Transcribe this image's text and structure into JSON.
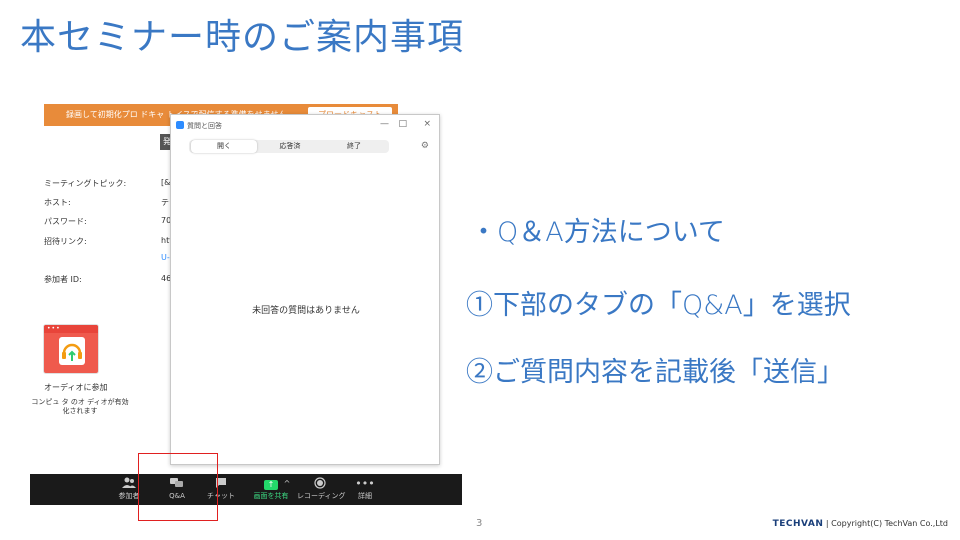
{
  "slide": {
    "title": "本セミナー時のご案内事項",
    "bullet": "・Q＆A方法について",
    "step1": "①下部のタブの「Q&A」を選択",
    "step2": "②ご質問内容を記載後「送信」",
    "page_number": "3",
    "footer_brand": "TECHVAN",
    "footer_copyright": "| Copyright(C) TechVan Co.,Ltd"
  },
  "zoom": {
    "banner_text": "録画して初期化プロ ドキャ トイスで配信する準備をせません",
    "banner_button": "プロードキャスト",
    "dark_tab": "発",
    "info": [
      {
        "label": "ミーティングトピック:",
        "value": "[&"
      },
      {
        "label": "ホスト:",
        "value": "テク"
      },
      {
        "label": "パスワード:",
        "value": "70"
      },
      {
        "label": "招待リンク:",
        "value": "htt"
      },
      {
        "label": "",
        "value": "U-c"
      },
      {
        "label": "参加者 ID:",
        "value": "46"
      }
    ],
    "audio_label": "オーディオに参加",
    "audio_sub": "コンピュ タ のオ ディオが有効化されます",
    "toolbar": [
      {
        "icon": "participants-icon",
        "label": "参加者"
      },
      {
        "icon": "qa-icon",
        "label": "Q&A"
      },
      {
        "icon": "chat-icon",
        "label": "チャット"
      },
      {
        "icon": "share-screen-icon",
        "label": "画面を共有"
      },
      {
        "icon": "record-icon",
        "label": "レコーディング"
      },
      {
        "icon": "more-icon",
        "label": "詳細"
      }
    ]
  },
  "qa": {
    "title": "質問と回答",
    "tabs": [
      "開く",
      "応答済",
      "終了"
    ],
    "active_tab": 0,
    "empty_message": "未回答の質問はありません",
    "controls": [
      "—",
      "□",
      "×"
    ]
  }
}
